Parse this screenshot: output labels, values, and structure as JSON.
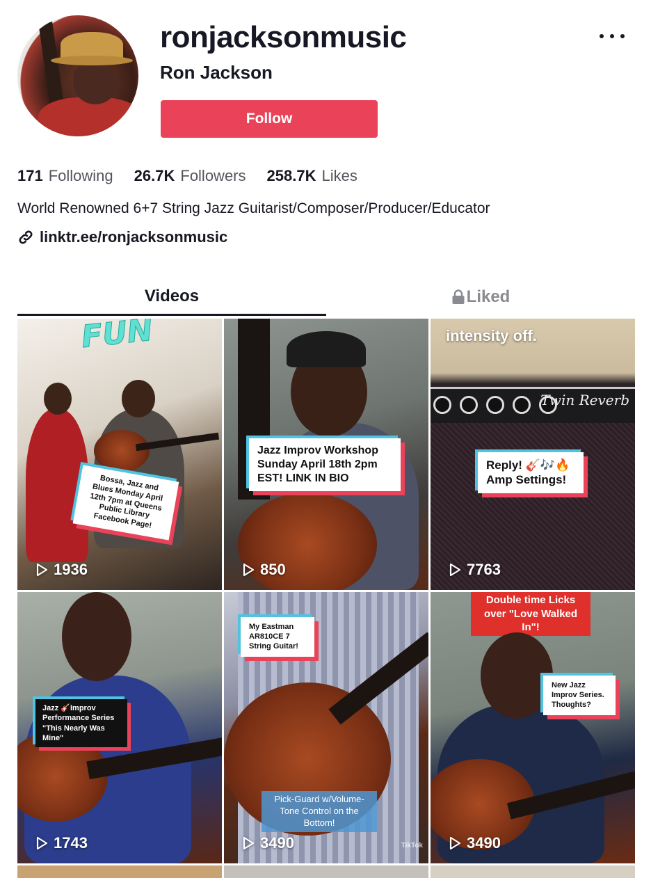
{
  "profile": {
    "username": "ronjacksonmusic",
    "display_name": "Ron Jackson",
    "follow_label": "Follow",
    "following_count": "171",
    "following_label": "Following",
    "followers_count": "26.7K",
    "followers_label": "Followers",
    "likes_count": "258.7K",
    "likes_label": "Likes",
    "bio": "World Renowned 6+7 String Jazz Guitarist/Composer/Producer/Educator",
    "link": "linktr.ee/ronjacksonmusic"
  },
  "tabs": {
    "videos": "Videos",
    "liked": "Liked"
  },
  "colors": {
    "follow_button": "#ea4359",
    "caption_pink": "#ea4359",
    "caption_cyan": "#4fc3e0"
  },
  "videos": [
    {
      "views": "1936",
      "overlay": "FUN",
      "caption": "Bossa, Jazz and Blues Monday April 12th 7pm at Queens Public Library Facebook Page!"
    },
    {
      "views": "850",
      "caption": "Jazz Improv Workshop Sunday April 18th 2pm EST! LINK IN BIO"
    },
    {
      "views": "7763",
      "overlay": "intensity off.",
      "caption": "Reply! 🎸🎶🔥 Amp Settings!",
      "amp_brand": "Twin Reverb"
    },
    {
      "views": "1743",
      "caption": "Jazz 🎸Improv Performance Series \"This Nearly Was Mine\""
    },
    {
      "views": "3490",
      "caption": "My Eastman AR810CE 7 String Guitar!",
      "subcaption": "Pick-Guard w/Volume-Tone Control on the Bottom!",
      "watermark": "TikTok"
    },
    {
      "views": "3490",
      "top_caption": "Double time Licks over \"Love Walked In\"!",
      "caption": "New Jazz Improv Series. Thoughts?"
    }
  ],
  "icons": {
    "more": "more-options-icon",
    "link": "link-icon",
    "lock": "lock-icon",
    "play": "play-icon"
  }
}
